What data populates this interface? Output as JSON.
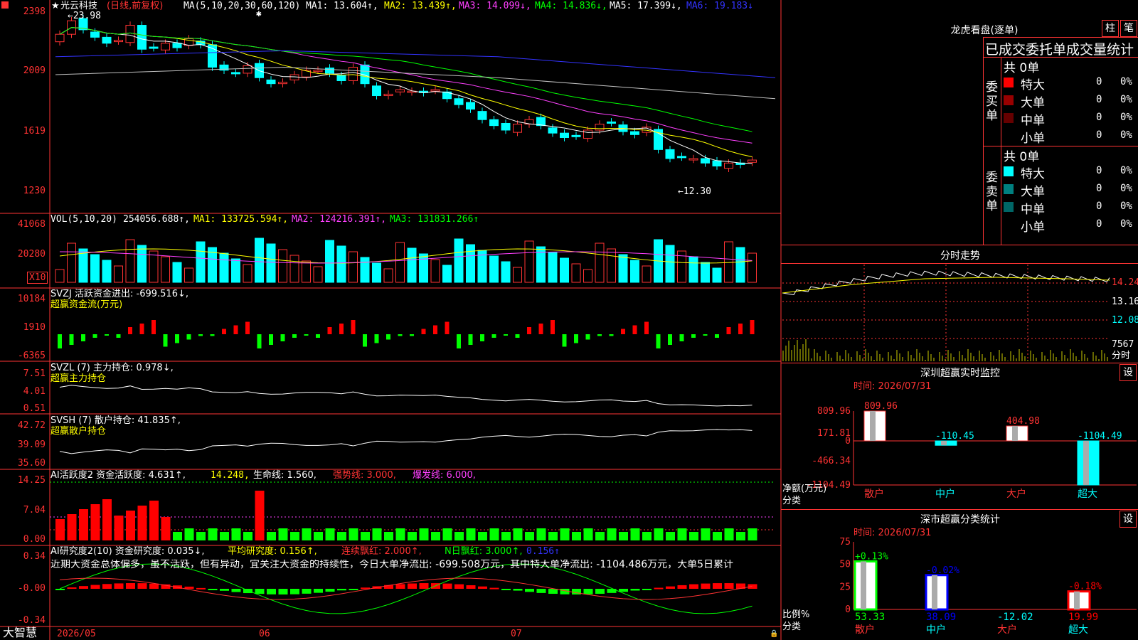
{
  "stock": {
    "name": "光云科技",
    "mode": "(日线,前复权)",
    "max_label": "←23.98",
    "min_label": "←12.30"
  },
  "colors": {
    "up": "#ff3333",
    "down": "#00ffff",
    "grid": "#ff3333"
  },
  "price_panel": {
    "ma_header": "MA(5,10,20,30,60,120)",
    "ma1": "MA1: 13.604↑,",
    "ma2": "MA2: 13.439↑,",
    "ma3": "MA3: 14.099↓,",
    "ma4": "MA4: 14.836↓,",
    "ma5": "MA5: 17.399↓,",
    "ma6": "MA6: 19.183↓",
    "y_labels": [
      "2398",
      "2009",
      "1619",
      "1230"
    ]
  },
  "vol_panel": {
    "header": "VOL(5,10,20)",
    "val": "254056.688↑,",
    "ma1": "MA1: 133725.594↑,",
    "ma2": "MA2: 124216.391↑,",
    "ma3": "MA3: 131831.266↑",
    "y_labels": [
      "41068",
      "20280"
    ],
    "unit": "X10"
  },
  "svzj_panel": {
    "header": "SVZJ  活跃资金进出: -699.516↓,",
    "sub": "超赢资金流(万元)",
    "y_labels": [
      "10184",
      "1910",
      "-6365"
    ]
  },
  "svzl_panel": {
    "header": "SVZL (7) 主力持仓: 0.978↓,",
    "sub": "超赢主力持仓",
    "y_labels": [
      "7.51",
      "4.01",
      "0.51"
    ]
  },
  "svsh_panel": {
    "header": "SVSH (7) 散户持仓: 41.835↑,",
    "sub": "超赢散户持仓",
    "y_labels": [
      "42.72",
      "39.09",
      "35.60"
    ]
  },
  "ai1_panel": {
    "header": "AI活跃度2 资金活跃度: 4.631↑,",
    "v1": "14.248,",
    "v2": "生命线: 1.560,",
    "v3": "强势线: 3.000,",
    "v4": "爆发线: 6.000,",
    "y_labels": [
      "14.25",
      "7.04",
      "0.00"
    ]
  },
  "ai2_panel": {
    "header": "AI研究度2(10) 资金研究度: 0.035↓,",
    "v1": "平均研究度: 0.156↑,",
    "v2": "连续飘红: 2.000↑,",
    "v3": "N日飘红: 3.000↑,",
    "v4": "0.156↑",
    "summary": "近期大资金总体偏多，虽不活跃，但有异动，宜关注大资金的持续性，今日大单净流出: -699.508万元，其中特大单净流出: -1104.486万元，大单5日累计",
    "y_labels": [
      "0.34",
      "-0.00",
      "-0.34"
    ]
  },
  "date_axis": {
    "labels": [
      "2026/05",
      "06",
      "07"
    ]
  },
  "brand": "大智慧",
  "right": {
    "dragon_title": "龙虎看盘(逐单)",
    "btn_a": "柱",
    "btn_b": "笔",
    "stat_title": "已成交委托单成交量统计",
    "buy": {
      "label": "委买单",
      "total": "共 0单",
      "rows": [
        {
          "name": "特大",
          "count": "0",
          "pct": "0%",
          "color": "#ff0000"
        },
        {
          "name": "大单",
          "count": "0",
          "pct": "0%",
          "color": "#990000"
        },
        {
          "name": "中单",
          "count": "0",
          "pct": "0%",
          "color": "#660000"
        },
        {
          "name": "小单",
          "count": "0",
          "pct": "0%",
          "color": "#000000"
        }
      ]
    },
    "sell": {
      "label": "委卖单",
      "total": "共 0单",
      "rows": [
        {
          "name": "特大",
          "count": "0",
          "pct": "0%",
          "color": "#00ffff"
        },
        {
          "name": "大单",
          "count": "0",
          "pct": "0%",
          "color": "#008080"
        },
        {
          "name": "中单",
          "count": "0",
          "pct": "0%",
          "color": "#006666"
        },
        {
          "name": "小单",
          "count": "0",
          "pct": "0%",
          "color": "#000000"
        }
      ]
    },
    "intraday_title": "分时走势",
    "intraday_y": [
      "14.24",
      "13.16",
      "12.08"
    ],
    "intraday_vol": "7567",
    "intraday_unit": "分时",
    "sz_title": "深圳超赢实时监控",
    "sz_btn": "设",
    "sz_time": "时间: 2026/07/31",
    "sz_y": [
      "809.96",
      "171.81",
      "0",
      "-466.34",
      "-1104.49"
    ],
    "sz_ylabel": "净额(万元)",
    "sz_xlabel": "分类",
    "sz_bars": [
      {
        "cat": "散户",
        "value": 809.96,
        "label": "809.96"
      },
      {
        "cat": "中户",
        "value": -110.45,
        "label": "-110.45"
      },
      {
        "cat": "大户",
        "value": 404.98,
        "label": "404.98"
      },
      {
        "cat": "超大",
        "value": -1104.49,
        "label": "-1104.49"
      }
    ],
    "sh_title": "深市超赢分类统计",
    "sh_btn": "设",
    "sh_time": "时间: 2026/07/31",
    "sh_y": [
      "75",
      "50",
      "25",
      "0"
    ],
    "sh_ylabel": "比例%",
    "sh_xlabel": "分类",
    "sh_bars": [
      {
        "cat": "散户",
        "value": 53.33,
        "label": "53.33",
        "change": "+0.13%"
      },
      {
        "cat": "中户",
        "value": 38.09,
        "label": "38.09",
        "change": "-0.02%"
      },
      {
        "cat": "大户",
        "value": -12.02,
        "label": "-12.02",
        "change": ""
      },
      {
        "cat": "超大",
        "value": 19.99,
        "label": "19.99",
        "change": "-0.18%"
      }
    ]
  }
}
